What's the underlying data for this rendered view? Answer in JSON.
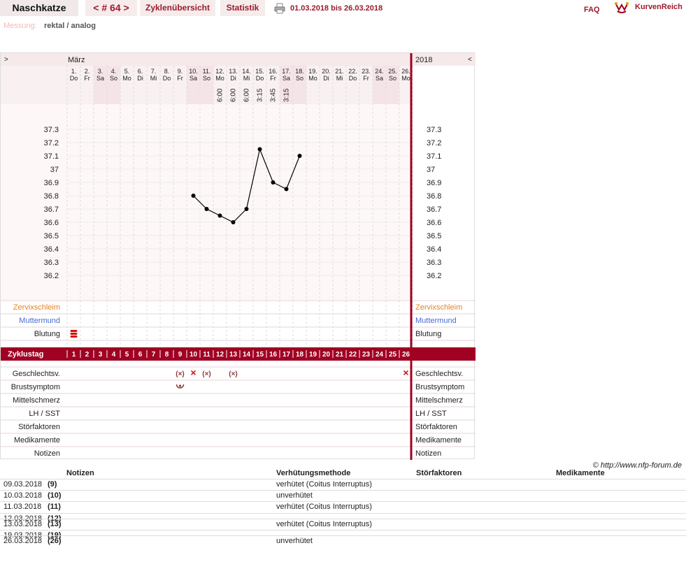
{
  "header": {
    "title": "Naschkatze",
    "cycle_nav": "< # 64 >",
    "tab_overview": "Zyklenübersicht",
    "tab_stats": "Statistik",
    "date_range": "01.03.2018 bis 26.03.2018",
    "faq": "FAQ",
    "brand": "KurvenReich"
  },
  "measurement": {
    "label": "Messung:",
    "value": "rektal / analog"
  },
  "chart": {
    "nav_prev": ">",
    "nav_next": "<",
    "month": "März",
    "year": "2018",
    "days": [
      {
        "n": "1.",
        "wd": "Do"
      },
      {
        "n": "2.",
        "wd": "Fr"
      },
      {
        "n": "3.",
        "wd": "Sa",
        "we": true
      },
      {
        "n": "4.",
        "wd": "So",
        "we": true
      },
      {
        "n": "5.",
        "wd": "Mo"
      },
      {
        "n": "6.",
        "wd": "Di"
      },
      {
        "n": "7.",
        "wd": "Mi"
      },
      {
        "n": "8.",
        "wd": "Do"
      },
      {
        "n": "9.",
        "wd": "Fr"
      },
      {
        "n": "10.",
        "wd": "Sa",
        "we": true
      },
      {
        "n": "11.",
        "wd": "So",
        "we": true
      },
      {
        "n": "12.",
        "wd": "Mo",
        "time": "6:00"
      },
      {
        "n": "13.",
        "wd": "Di",
        "time": "6:00"
      },
      {
        "n": "14.",
        "wd": "Mi",
        "time": "6:00"
      },
      {
        "n": "15.",
        "wd": "Do",
        "time": "3:15"
      },
      {
        "n": "16.",
        "wd": "Fr",
        "time": "3:45"
      },
      {
        "n": "17.",
        "wd": "Sa",
        "we": true,
        "time": "3:15"
      },
      {
        "n": "18.",
        "wd": "So",
        "we": true
      },
      {
        "n": "19.",
        "wd": "Mo"
      },
      {
        "n": "20.",
        "wd": "Di"
      },
      {
        "n": "21.",
        "wd": "Mi"
      },
      {
        "n": "22.",
        "wd": "Do"
      },
      {
        "n": "23.",
        "wd": "Fr"
      },
      {
        "n": "24.",
        "wd": "Sa",
        "we": true
      },
      {
        "n": "25.",
        "wd": "So",
        "we": true
      },
      {
        "n": "26.",
        "wd": "Mo"
      }
    ],
    "temp_ticks": [
      "37.3",
      "37.2",
      "37.1",
      "37",
      "36.9",
      "36.8",
      "36.7",
      "36.6",
      "36.5",
      "36.4",
      "36.3",
      "36.2"
    ],
    "temps": [
      {
        "day": 10,
        "t": 36.8
      },
      {
        "day": 11,
        "t": 36.7
      },
      {
        "day": 12,
        "t": 36.65
      },
      {
        "day": 13,
        "t": 36.6
      },
      {
        "day": 14,
        "t": 36.7
      },
      {
        "day": 15,
        "t": 37.15
      },
      {
        "day": 16,
        "t": 36.9
      },
      {
        "day": 17,
        "t": 36.85
      },
      {
        "day": 18,
        "t": 37.1
      }
    ],
    "rows_top": [
      {
        "label": "Zervixschleim",
        "color": "#e8821e"
      },
      {
        "label": "Muttermund",
        "color": "#4a6ad0"
      },
      {
        "label": "Blutung",
        "color": "#222222"
      }
    ],
    "cycle_day_label": "Zyklustag",
    "cycle_days": [
      "1",
      "2",
      "3",
      "4",
      "5",
      "6",
      "7",
      "8",
      "9",
      "10",
      "11",
      "12",
      "13",
      "14",
      "15",
      "16",
      "17",
      "18",
      "19",
      "20",
      "21",
      "22",
      "23",
      "24",
      "25",
      "26"
    ],
    "rows_bottom": [
      "Geschlechtsv.",
      "Brustsymptom",
      "Mittelschmerz",
      "LH / SST",
      "Störfaktoren",
      "Medikamente",
      "Notizen"
    ],
    "bleeding_day": 1,
    "intercourse": [
      {
        "day": 9,
        "sym": "(×)",
        "protected": true
      },
      {
        "day": 10,
        "sym": "×",
        "protected": false
      },
      {
        "day": 11,
        "sym": "(×)",
        "protected": true
      },
      {
        "day": 13,
        "sym": "(×)",
        "protected": true
      },
      {
        "day": 26,
        "sym": "×",
        "protected": false
      }
    ],
    "breast_day": 9,
    "colors": {
      "accent": "#a00022",
      "grid": "#f5e9e9",
      "line": "#000000",
      "weekend": "#f5e4e7"
    }
  },
  "notes": {
    "copyright": "© http://www.nfp-forum.de",
    "headers": {
      "notes": "Notizen",
      "method": "Verhütungsmethode",
      "faults": "Störfaktoren",
      "meds": "Medikamente"
    },
    "rows": [
      {
        "date": "09.03.2018",
        "cd": "(9)",
        "method": "verhütet (Coitus Interruptus)"
      },
      {
        "date": "10.03.2018",
        "cd": "(10)",
        "method": "unverhütet"
      },
      {
        "date": "11.03.2018",
        "cd": "(11)",
        "method": "verhütet (Coitus Interruptus)"
      },
      {
        "date": "12.03.2018",
        "cd": "(12)",
        "method": ""
      },
      {
        "date": "13.03.2018",
        "cd": "(13)",
        "method": "verhütet (Coitus Interruptus)"
      },
      {
        "date": "19.03.2018",
        "cd": "(19)",
        "method": ""
      },
      {
        "date": "26.03.2018",
        "cd": "(26)",
        "method": "unverhütet"
      }
    ]
  }
}
